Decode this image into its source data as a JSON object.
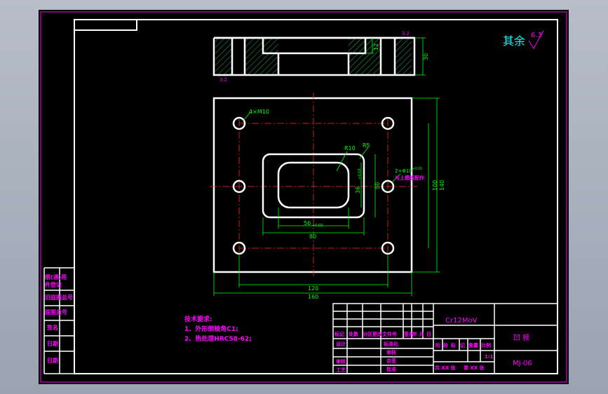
{
  "title_block": {
    "material": "Cr12MoV",
    "part_name": "凹 模",
    "drawing_no": "MJ-06",
    "scale": "1:1",
    "sheets_total": "共 XX 张",
    "sheet_no": "第 XX 张",
    "header_row": [
      "标记",
      "处数",
      "分区",
      "更改文件号",
      "签名",
      "年",
      "月",
      "日"
    ],
    "left_rows": [
      "设计",
      "审核",
      "工艺"
    ],
    "mid_rows": [
      "标准化",
      "审核",
      "会签",
      "批准"
    ],
    "right_headers": [
      "阶",
      "段",
      "标",
      "记",
      "重量",
      "比例"
    ]
  },
  "left_strip": [
    "借(通)用",
    "件登记",
    "旧底图总号",
    "底图总号",
    "签名",
    "日期",
    "日期"
  ],
  "roughness_note": "其余",
  "roughness_value": "6.3",
  "tech_requirements": {
    "heading": "技术要求:",
    "items": [
      "1、外形倒棱角C1;",
      "2、热处理HRC58-62;"
    ]
  },
  "dimensions": {
    "holes": "4×M10",
    "pins": "2×Φ10",
    "pins_tol": "+0.01",
    "pin_note": "与上模板配作",
    "r10": "R10",
    "r5": "R5",
    "cavity_w": "56",
    "cavity_w_tol": "+0.03",
    "cavity_h": "36",
    "cavity_h_tol": "+0.03",
    "d80": "80",
    "d50": "50",
    "d100": "100",
    "d140": "140",
    "d120": "120",
    "d160": "160",
    "d30": "30",
    "d12": "12",
    "top_rough": "3.2",
    "bottom_rough": "3.2"
  }
}
